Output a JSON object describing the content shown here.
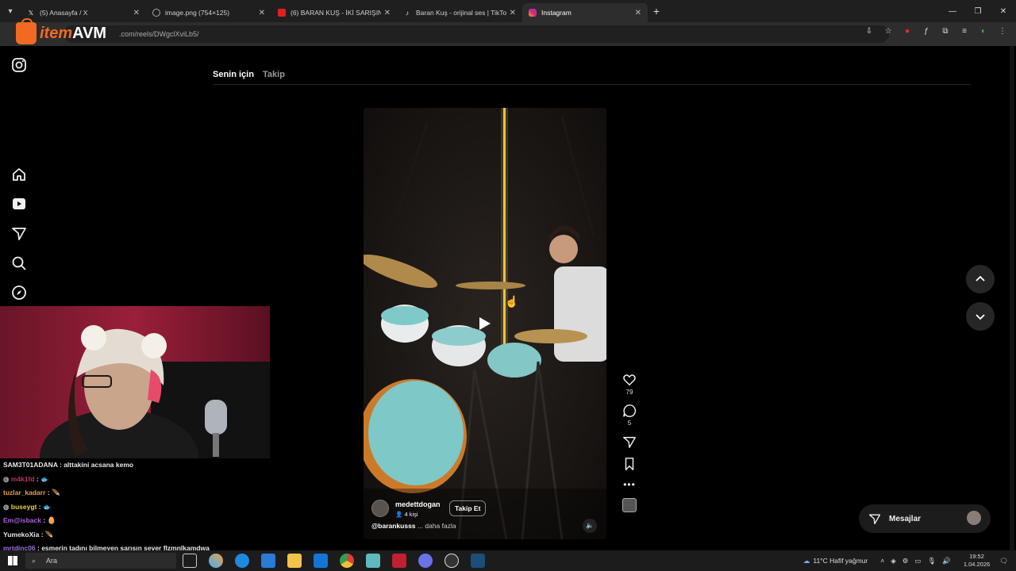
{
  "browser": {
    "tabs": [
      {
        "title": "(5) Anasayfa / X",
        "favicon": "x-icon",
        "active": false
      },
      {
        "title": "image.png (754×125)",
        "favicon": "globe-icon",
        "active": false
      },
      {
        "title": "(6) BARAN KUŞ - İKİ SARIŞIN (C",
        "favicon": "youtube-icon",
        "active": false
      },
      {
        "title": "Baran Kuş - orijinal ses | TikTok",
        "favicon": "tiktok-icon",
        "active": false
      },
      {
        "title": "Instagram",
        "favicon": "instagram-icon",
        "active": true
      }
    ],
    "url": ".com/reels/DWgclXviLb5/"
  },
  "overlay_logo": {
    "part1": "item",
    "part2": "AVM"
  },
  "feed": {
    "tabs": [
      {
        "label": "Senin için",
        "active": true
      },
      {
        "label": "Takip",
        "active": false
      }
    ]
  },
  "reel": {
    "username": "medettdogan",
    "followers": "4 kişi",
    "follow_label": "Takip Et",
    "caption_handle": "@barankusss",
    "caption_more": "... daha fazla",
    "likes": "79",
    "comments": "5"
  },
  "messages_button": "Mesajlar",
  "chat": [
    {
      "user": "SAM3T01ADANA",
      "message": "alttakini acsana kemo",
      "color": "#e8e8e8"
    },
    {
      "user": "m4k1fd",
      "message": "🐟",
      "color": "#c0306a"
    },
    {
      "user": "tuzlar_kadarr",
      "message": "🪶",
      "color": "#e8a040"
    },
    {
      "user": "buseygt",
      "message": "🐟",
      "color": "#e8d040"
    },
    {
      "user": "Em@isback",
      "message": "🥚",
      "color": "#b060e0"
    },
    {
      "user": "YumekoXia",
      "message": "🪶",
      "color": "#e8e8e8"
    },
    {
      "user": "mrtdinc06",
      "message": "esmerin tadını bilmeyen sarışın sever flzmnlkamdwa",
      "color": "#a070e0"
    }
  ],
  "taskbar": {
    "search_placeholder": "Ara",
    "weather": "11°C  Hafif yağmur",
    "time": "19:52",
    "date": "1.04.2026"
  }
}
